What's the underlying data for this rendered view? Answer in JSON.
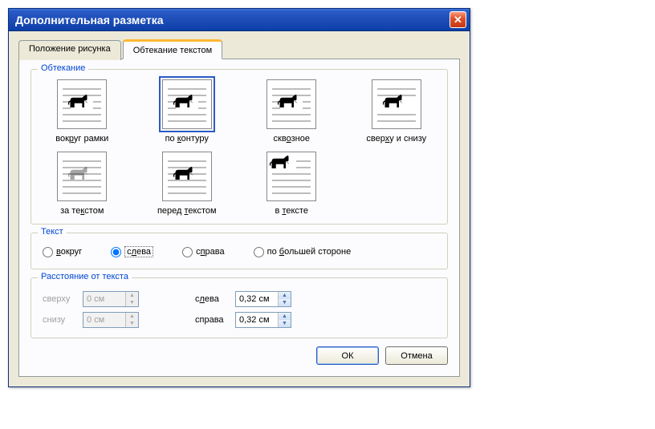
{
  "window": {
    "title": "Дополнительная разметка"
  },
  "tabs": {
    "position": "Положение рисунка",
    "wrapping": "Обтекание текстом"
  },
  "wrap": {
    "legend": "Обтекание",
    "items": [
      {
        "label": "вокруг рамки",
        "key": "square"
      },
      {
        "label": "по контуру",
        "key": "tight",
        "selected": true
      },
      {
        "label": "сквозное",
        "key": "through"
      },
      {
        "label": "сверху и снизу",
        "key": "topbottom"
      },
      {
        "label": "за текстом",
        "key": "behind"
      },
      {
        "label": "перед текстом",
        "key": "infront"
      },
      {
        "label": "в тексте",
        "key": "inline"
      }
    ],
    "hotkeys": [
      "р",
      "к",
      "о",
      "х",
      "к",
      "т",
      "т"
    ]
  },
  "textside": {
    "legend": "Текст",
    "options": [
      "вокруг",
      "слева",
      "справа",
      "по большей стороне"
    ],
    "hotkeys": [
      "в",
      "л",
      "п",
      "б"
    ],
    "selected": 1
  },
  "distance": {
    "legend": "Расстояние от текста",
    "top_label": "сверху",
    "top": "0 см",
    "top_enabled": false,
    "bottom_label": "снизу",
    "bottom": "0 см",
    "bottom_enabled": false,
    "left_label": "слева",
    "left": "0,32 см",
    "left_enabled": true,
    "left_hot": "л",
    "right_label": "справа",
    "right": "0,32 см",
    "right_enabled": true
  },
  "buttons": {
    "ok": "ОК",
    "cancel": "Отмена"
  }
}
